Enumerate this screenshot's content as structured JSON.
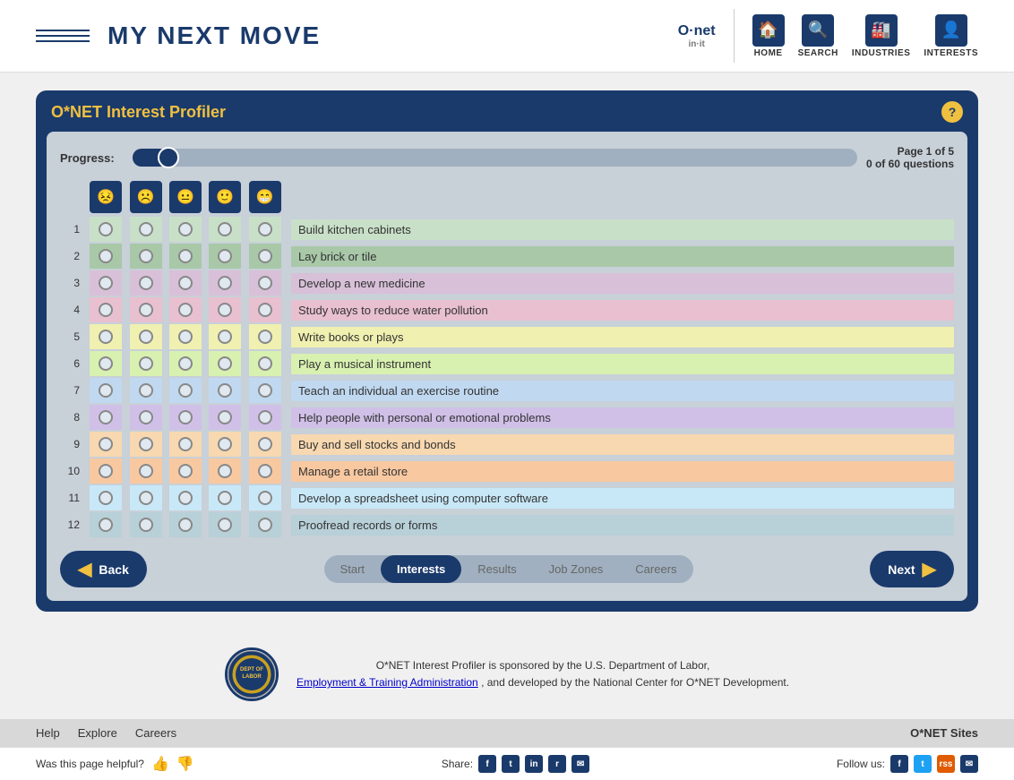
{
  "header": {
    "logo_text": "MY NEXT MOVE",
    "logo_arrow": "▶",
    "onet_name": "O·net",
    "onet_sub": "in·it",
    "nav_items": [
      {
        "id": "home",
        "label": "HOME",
        "icon": "🏠"
      },
      {
        "id": "search",
        "label": "SEARCH",
        "icon": "🔍"
      },
      {
        "id": "industries",
        "label": "INDUSTRIES",
        "icon": "🏭"
      },
      {
        "id": "interests",
        "label": "INTERESTS",
        "icon": "👤"
      }
    ]
  },
  "profiler": {
    "title": "O*NET Interest Profiler",
    "help_label": "?",
    "progress_label": "Progress:",
    "page_info_line1": "Page 1 of 5",
    "page_info_line2": "0 of 60 questions",
    "rating_icons": [
      "😣",
      "☹",
      "😐",
      "🙂",
      "😁"
    ],
    "questions": [
      {
        "num": 1,
        "text": "Build kitchen cabinets"
      },
      {
        "num": 2,
        "text": "Lay brick or tile"
      },
      {
        "num": 3,
        "text": "Develop a new medicine"
      },
      {
        "num": 4,
        "text": "Study ways to reduce water pollution"
      },
      {
        "num": 5,
        "text": "Write books or plays"
      },
      {
        "num": 6,
        "text": "Play a musical instrument"
      },
      {
        "num": 7,
        "text": "Teach an individual an exercise routine"
      },
      {
        "num": 8,
        "text": "Help people with personal or emotional problems"
      },
      {
        "num": 9,
        "text": "Buy and sell stocks and bonds"
      },
      {
        "num": 10,
        "text": "Manage a retail store"
      },
      {
        "num": 11,
        "text": "Develop a spreadsheet using computer software"
      },
      {
        "num": 12,
        "text": "Proofread records or forms"
      }
    ],
    "steps": [
      {
        "label": "Start",
        "active": false
      },
      {
        "label": "Interests",
        "active": true
      },
      {
        "label": "Results",
        "active": false
      },
      {
        "label": "Job Zones",
        "active": false
      },
      {
        "label": "Careers",
        "active": false
      }
    ],
    "back_label": "Back",
    "next_label": "Next"
  },
  "sponsor": {
    "text1": "O*NET Interest Profiler is sponsored by the U.S. Department of Labor,",
    "link_text": "Employment & Training Administration",
    "text2": ", and developed by the National Center for O*NET Development."
  },
  "bottom_nav": {
    "links": [
      "Help",
      "Explore",
      "Careers"
    ],
    "onet_sites": "O*NET Sites"
  },
  "footer": {
    "helpful_text": "Was this page helpful?",
    "share_text": "Share:",
    "follow_text": "Follow us:"
  }
}
